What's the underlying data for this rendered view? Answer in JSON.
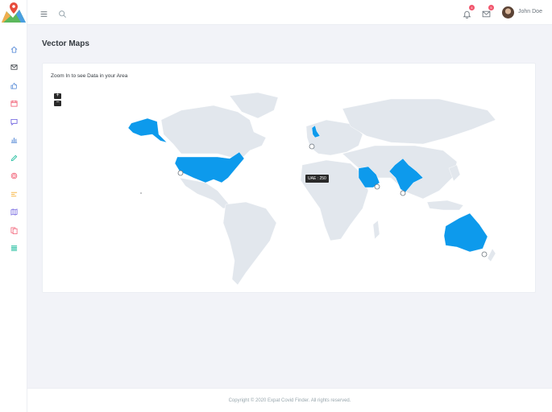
{
  "header": {
    "menu_icon": "menu-icon",
    "search_icon": "search-icon",
    "notifications": {
      "icon": "bell-icon",
      "count": "4"
    },
    "messages": {
      "icon": "mail-icon",
      "count": "5"
    },
    "user": {
      "name": "John Doe"
    }
  },
  "sidebar": {
    "items": [
      {
        "icon": "home-icon",
        "color": "#4a81d4"
      },
      {
        "icon": "mail-icon",
        "color": "#343a40"
      },
      {
        "icon": "thumbs-up-icon",
        "color": "#4a81d4"
      },
      {
        "icon": "calendar-icon",
        "color": "#f1556c"
      },
      {
        "icon": "chat-icon",
        "color": "#6658dd"
      },
      {
        "icon": "bar-chart-icon",
        "color": "#4a81d4"
      },
      {
        "icon": "pen-icon",
        "color": "#1abc9c"
      },
      {
        "icon": "fingerprint-icon",
        "color": "#f1556c"
      },
      {
        "icon": "bars-icon",
        "color": "#f7b84b"
      },
      {
        "icon": "map-icon",
        "color": "#6658dd"
      },
      {
        "icon": "documents-icon",
        "color": "#f1556c"
      },
      {
        "icon": "list-icon",
        "color": "#1abc9c"
      }
    ]
  },
  "page": {
    "title": "Vector Maps"
  },
  "card": {
    "title": "Zoom In to see Data in your Area",
    "zoom_in_label": "+",
    "zoom_out_label": "−",
    "tooltip": "UAE : 250"
  },
  "map": {
    "land_color": "#e2e7ed",
    "highlight_color": "#0d9aec",
    "highlighted": [
      "Alaska",
      "United States",
      "United Kingdom",
      "Saudi Arabia",
      "India",
      "Australia"
    ]
  },
  "footer": {
    "text": "Copyright © 2020 Expat Covid Finder. All rights reserved."
  }
}
